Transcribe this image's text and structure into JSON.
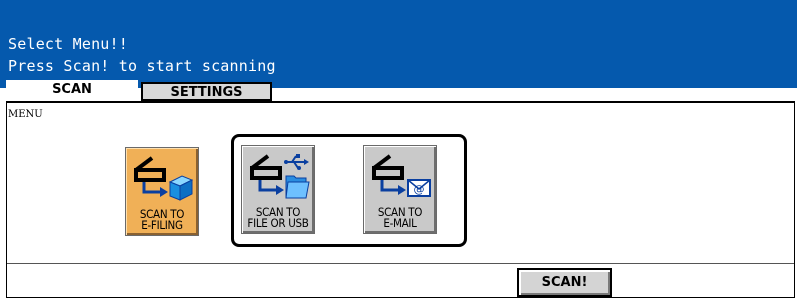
{
  "header": {
    "line1": "Select Menu!!",
    "line2": "Press Scan! to start scanning",
    "background_color": "#0559ad"
  },
  "tabs": [
    {
      "label": "SCAN",
      "active": true
    },
    {
      "label": "SETTINGS",
      "active": false
    }
  ],
  "panel": {
    "label": "MENU"
  },
  "functions": [
    {
      "line1": "SCAN TO",
      "line2": "E-FILING",
      "icon": "scanner-to-box-icon",
      "active": true,
      "color": "#f0b057"
    },
    {
      "line1": "SCAN TO",
      "line2": "FILE OR USB",
      "icon": "scanner-to-usb-folder-icon",
      "active": false,
      "color": "#c9c9c9"
    },
    {
      "line1": "SCAN TO",
      "line2": "E-MAIL",
      "icon": "scanner-to-email-icon",
      "active": false,
      "color": "#c9c9c9"
    }
  ],
  "scan_button": {
    "label": "SCAN!"
  }
}
